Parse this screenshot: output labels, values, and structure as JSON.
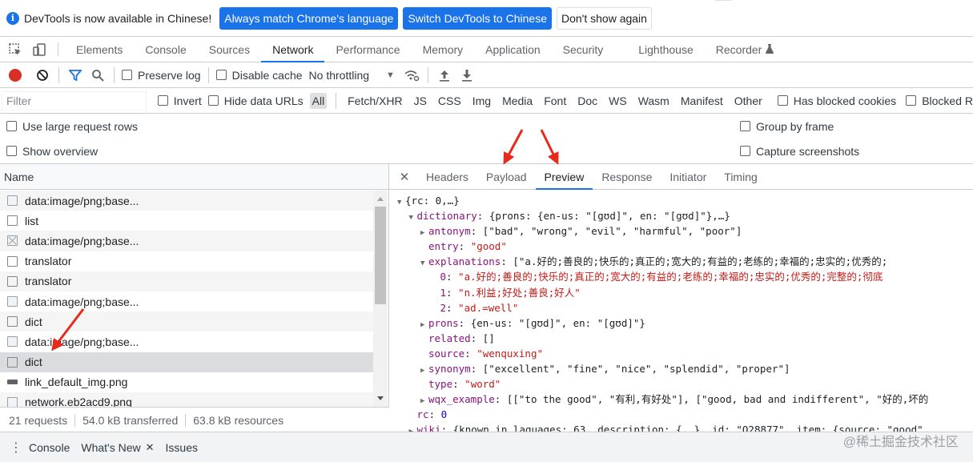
{
  "infobar": {
    "message": "DevTools is now available in Chinese!",
    "match_language_label": "Always match Chrome's language",
    "switch_label": "Switch DevTools to Chinese",
    "dismiss_label": "Don't show again"
  },
  "main_tabs": [
    "Elements",
    "Console",
    "Sources",
    "Network",
    "Performance",
    "Memory",
    "Application",
    "Security",
    "Lighthouse",
    "Recorder"
  ],
  "active_main_tab": "Network",
  "network_toolbar": {
    "preserve_log": "Preserve log",
    "disable_cache": "Disable cache",
    "throttling": "No throttling"
  },
  "filter_bar": {
    "placeholder": "Filter",
    "invert": "Invert",
    "hide_data_urls": "Hide data URLs",
    "types": [
      "All",
      "Fetch/XHR",
      "JS",
      "CSS",
      "Img",
      "Media",
      "Font",
      "Doc",
      "WS",
      "Wasm",
      "Manifest",
      "Other"
    ],
    "active_type": "All",
    "has_blocked_cookies": "Has blocked cookies",
    "blocked_requests": "Blocked R"
  },
  "options": {
    "large_rows": "Use large request rows",
    "overview": "Show overview",
    "group_by_frame": "Group by frame",
    "capture_screenshots": "Capture screenshots"
  },
  "request_list": {
    "header": "Name",
    "rows": [
      {
        "name": "data:image/png;base...",
        "icon": "image-icon"
      },
      {
        "name": "list",
        "icon": "document-icon"
      },
      {
        "name": "data:image/png;base...",
        "icon": "broken-image-icon"
      },
      {
        "name": "translator",
        "icon": "document-icon"
      },
      {
        "name": "translator",
        "icon": "document-icon"
      },
      {
        "name": "data:image/png;base...",
        "icon": "image-icon"
      },
      {
        "name": "dict",
        "icon": "document-icon"
      },
      {
        "name": "data:image/png;base...",
        "icon": "image-icon"
      },
      {
        "name": "dict",
        "icon": "document-icon"
      },
      {
        "name": "link_default_img.png",
        "icon": "png-icon"
      },
      {
        "name": "network.eb2acd9.png",
        "icon": "image-icon"
      }
    ],
    "selected_index": 8
  },
  "status": {
    "requests": "21 requests",
    "transferred": "54.0 kB transferred",
    "resources": "63.8 kB resources"
  },
  "detail_tabs": [
    "Headers",
    "Payload",
    "Preview",
    "Response",
    "Initiator",
    "Timing"
  ],
  "active_detail_tab": "Preview",
  "preview_lines": [
    {
      "indent": 0,
      "toggle": "open",
      "segments": [
        {
          "t": "{rc: 0,…}",
          "c": "plain"
        }
      ]
    },
    {
      "indent": 1,
      "toggle": "open",
      "segments": [
        {
          "t": "dictionary",
          "c": "key"
        },
        {
          "t": ": {prons: {en-us: \"[gʊd]\", en: \"[gʊd]\"},…}",
          "c": "plain"
        }
      ]
    },
    {
      "indent": 2,
      "toggle": "closed",
      "segments": [
        {
          "t": "antonym",
          "c": "key"
        },
        {
          "t": ": [\"bad\", \"wrong\", \"evil\", \"harmful\", \"poor\"]",
          "c": "plain"
        }
      ]
    },
    {
      "indent": 2,
      "toggle": "none",
      "segments": [
        {
          "t": "entry",
          "c": "key"
        },
        {
          "t": ": ",
          "c": "plain"
        },
        {
          "t": "\"good\"",
          "c": "str"
        }
      ]
    },
    {
      "indent": 2,
      "toggle": "open",
      "segments": [
        {
          "t": "explanations",
          "c": "key"
        },
        {
          "t": ": [\"a.好的;善良的;快乐的;真正的;宽大的;有益的;老练的;幸福的;忠实的;优秀的;",
          "c": "plain"
        }
      ]
    },
    {
      "indent": 3,
      "toggle": "none",
      "segments": [
        {
          "t": "0",
          "c": "key"
        },
        {
          "t": ": ",
          "c": "plain"
        },
        {
          "t": "\"a.好的;善良的;快乐的;真正的;宽大的;有益的;老练的;幸福的;忠实的;优秀的;完整的;彻底",
          "c": "str"
        }
      ]
    },
    {
      "indent": 3,
      "toggle": "none",
      "segments": [
        {
          "t": "1",
          "c": "key"
        },
        {
          "t": ": ",
          "c": "plain"
        },
        {
          "t": "\"n.利益;好处;善良;好人\"",
          "c": "str"
        }
      ]
    },
    {
      "indent": 3,
      "toggle": "none",
      "segments": [
        {
          "t": "2",
          "c": "key"
        },
        {
          "t": ": ",
          "c": "plain"
        },
        {
          "t": "\"ad.=well\"",
          "c": "str"
        }
      ]
    },
    {
      "indent": 2,
      "toggle": "closed",
      "segments": [
        {
          "t": "prons",
          "c": "key"
        },
        {
          "t": ": {en-us: \"[gʊd]\", en: \"[gʊd]\"}",
          "c": "plain"
        }
      ]
    },
    {
      "indent": 2,
      "toggle": "none",
      "segments": [
        {
          "t": "related",
          "c": "key"
        },
        {
          "t": ": []",
          "c": "plain"
        }
      ]
    },
    {
      "indent": 2,
      "toggle": "none",
      "segments": [
        {
          "t": "source",
          "c": "key"
        },
        {
          "t": ": ",
          "c": "plain"
        },
        {
          "t": "\"wenquxing\"",
          "c": "str"
        }
      ]
    },
    {
      "indent": 2,
      "toggle": "closed",
      "segments": [
        {
          "t": "synonym",
          "c": "key"
        },
        {
          "t": ": [\"excellent\", \"fine\", \"nice\", \"splendid\", \"proper\"]",
          "c": "plain"
        }
      ]
    },
    {
      "indent": 2,
      "toggle": "none",
      "segments": [
        {
          "t": "type",
          "c": "key"
        },
        {
          "t": ": ",
          "c": "plain"
        },
        {
          "t": "\"word\"",
          "c": "str"
        }
      ]
    },
    {
      "indent": 2,
      "toggle": "closed",
      "segments": [
        {
          "t": "wqx_example",
          "c": "key"
        },
        {
          "t": ": [[\"to the good\", \"有利,有好处\"], [\"good, bad and indifferent\", \"好的,坏的",
          "c": "plain"
        }
      ]
    },
    {
      "indent": 1,
      "toggle": "none",
      "segments": [
        {
          "t": "rc",
          "c": "key"
        },
        {
          "t": ": ",
          "c": "plain"
        },
        {
          "t": "0",
          "c": "num"
        }
      ]
    },
    {
      "indent": 1,
      "toggle": "closed",
      "segments": [
        {
          "t": "wiki",
          "c": "key"
        },
        {
          "t": ": {known_in_laguages: 63, description: {,…}, id: \"Q28877\", item: {source: \"good\",",
          "c": "plain"
        }
      ]
    }
  ],
  "drawer": {
    "tabs": [
      "Console",
      "What's New",
      "Issues"
    ]
  },
  "watermark": "@稀土掘金技术社区",
  "colors": {
    "accent": "#1a73e8",
    "record": "#d93025",
    "json_key": "#881280",
    "json_string": "#c41a16",
    "annotation_arrow": "#e8291c"
  }
}
